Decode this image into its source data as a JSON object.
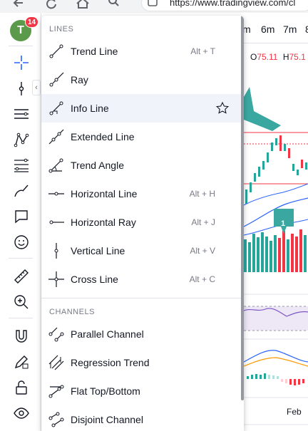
{
  "browser": {
    "url": "https://www.tradingview.com/cl",
    "icons": [
      "back-arrow-icon",
      "reload-icon",
      "home-icon",
      "search-icon",
      "site-info-icon"
    ]
  },
  "avatar": {
    "letter": "T",
    "badge": "14"
  },
  "toolbar": {
    "icons": [
      "crosshair-icon",
      "cursor-icon",
      "lines-icon",
      "pattern-icon",
      "fib-icon",
      "brush-icon",
      "comment-icon",
      "emoji-icon",
      "ruler-icon",
      "zoom-in-icon",
      "magnet-icon",
      "pencil-lock-icon",
      "lock-icon",
      "eye-icon"
    ]
  },
  "chart": {
    "timeframes": [
      "m",
      "6m",
      "7m",
      "8"
    ],
    "ohlc": {
      "o_label": "O",
      "o_value": "75.11",
      "h_label": "H",
      "h_value": "75.1"
    },
    "badge": "1",
    "x_label": "Feb",
    "colors": {
      "up": "#26a69a",
      "down": "#f23645",
      "accent": "#2962ff"
    }
  },
  "menu": {
    "sections": [
      {
        "title": "LINES",
        "items": [
          {
            "label": "Trend Line",
            "shortcut": "Alt + T",
            "icon": "trend-line-icon"
          },
          {
            "label": "Ray",
            "shortcut": "",
            "icon": "ray-icon"
          },
          {
            "label": "Info Line",
            "shortcut": "",
            "icon": "info-line-icon",
            "star": true
          },
          {
            "label": "Extended Line",
            "shortcut": "",
            "icon": "extended-line-icon"
          },
          {
            "label": "Trend Angle",
            "shortcut": "",
            "icon": "trend-angle-icon"
          },
          {
            "label": "Horizontal Line",
            "shortcut": "Alt + H",
            "icon": "horizontal-line-icon"
          },
          {
            "label": "Horizontal Ray",
            "shortcut": "Alt + J",
            "icon": "horizontal-ray-icon"
          },
          {
            "label": "Vertical Line",
            "shortcut": "Alt + V",
            "icon": "vertical-line-icon"
          },
          {
            "label": "Cross Line",
            "shortcut": "Alt + C",
            "icon": "cross-line-icon"
          }
        ]
      },
      {
        "title": "CHANNELS",
        "items": [
          {
            "label": "Parallel Channel",
            "shortcut": "",
            "icon": "parallel-channel-icon"
          },
          {
            "label": "Regression Trend",
            "shortcut": "",
            "icon": "regression-trend-icon"
          },
          {
            "label": "Flat Top/Bottom",
            "shortcut": "",
            "icon": "flat-top-bottom-icon"
          },
          {
            "label": "Disjoint Channel",
            "shortcut": "",
            "icon": "disjoint-channel-icon"
          }
        ]
      }
    ]
  }
}
